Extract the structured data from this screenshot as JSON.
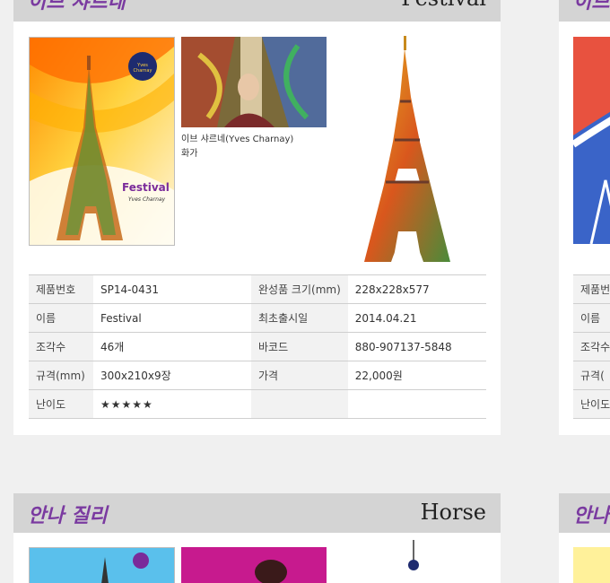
{
  "card1": {
    "artist": "이브 샤르네",
    "title": "Festival",
    "poster": {
      "logo_text": "Yves Charnay",
      "festival_word": "Festival",
      "signature": "Yves Charnay"
    },
    "artist_caption": {
      "name": "이브 샤르네(Yves Charnay)",
      "role": "화가"
    },
    "specs": [
      {
        "l1": "제품번호",
        "v1": "SP14-0431",
        "l2": "완성품 크기(mm)",
        "v2": "228x228x577"
      },
      {
        "l1": "이름",
        "v1": "Festival",
        "l2": "최초출시일",
        "v2": "2014.04.21"
      },
      {
        "l1": "조각수",
        "v1": "46개",
        "l2": "바코드",
        "v2": "880-907137-5848"
      },
      {
        "l1": "규격(mm)",
        "v1": "300x210x9장",
        "l2": "가격",
        "v2": "22,000원"
      },
      {
        "l1": "난이도",
        "v1": "★★★★★",
        "l2": "",
        "v2": ""
      }
    ]
  },
  "card2": {
    "artist": "안나 질리",
    "title": "Horse"
  },
  "right_partial": {
    "artist_top": "이브",
    "artist_bottom": "안나",
    "labels": [
      "제품번",
      "이름",
      "조각수",
      "규격(",
      "난이도"
    ]
  },
  "colors": {
    "accent": "#7a3aa0",
    "header_bg": "#d4d4d4",
    "label_bg": "#f2f2f2"
  }
}
